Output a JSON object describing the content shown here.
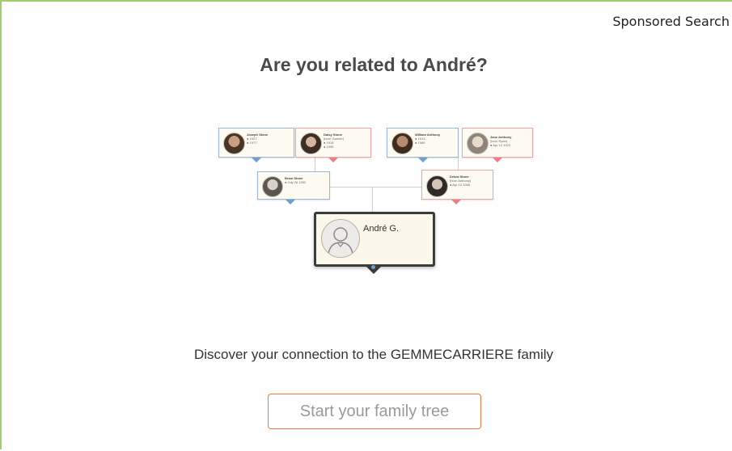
{
  "ad": {
    "sponsored_label": "Sponsored Search",
    "headline": "Are you related to André?",
    "discover_text": "Discover your connection to the GEMMECARRIERE family",
    "cta_label": "Start your family tree"
  },
  "tree": {
    "root": {
      "name": "André G.",
      "icon": "person-silhouette-icon"
    },
    "parents": [
      {
        "name": "Brian Stone",
        "lines": [
          "● July 26 1952"
        ],
        "gender": "male"
      },
      {
        "name": "Debra Stone",
        "lines": [
          "(born Anthony)",
          "● Apr 12 1965"
        ],
        "gender": "female"
      }
    ],
    "grandparents": [
      {
        "name": "Joseph Stone",
        "lines": [
          "● 1927",
          "● 1977"
        ],
        "gender": "male"
      },
      {
        "name": "Daisy Stone",
        "lines": [
          "(born Garnier)",
          "● 1915",
          "● 1999"
        ],
        "gender": "female"
      },
      {
        "name": "William Anthony",
        "lines": [
          "● 1913",
          "● 1989"
        ],
        "gender": "male"
      },
      {
        "name": "Jane Anthony",
        "lines": [
          "(born Ryan)",
          "● Apr 12 1922"
        ],
        "gender": "female"
      }
    ]
  },
  "colors": {
    "frame_border": "#9fcf6a",
    "male_accent": "#6e9dcf",
    "female_accent": "#ec7f86",
    "cta_border": "#e67c3f"
  }
}
